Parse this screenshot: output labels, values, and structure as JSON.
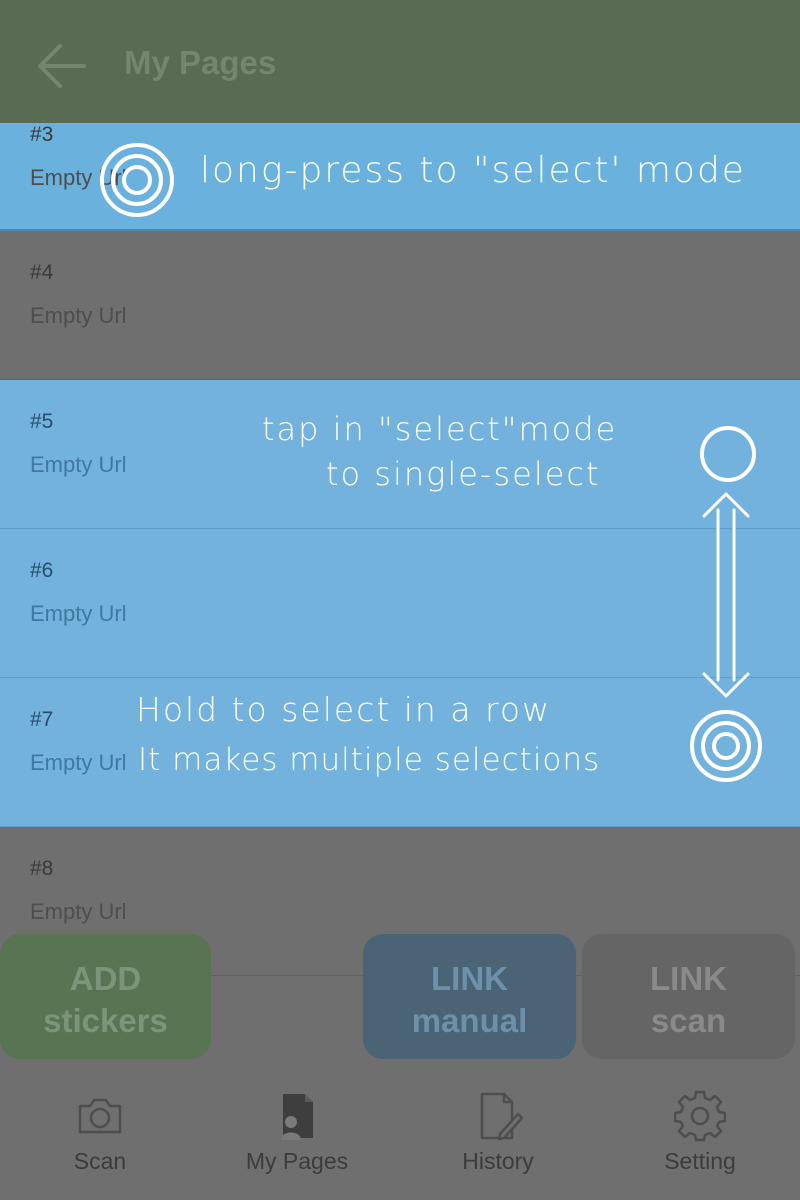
{
  "app_bar": {
    "title": "My Pages"
  },
  "rows": [
    {
      "num": "#3",
      "url": "Empty Url"
    },
    {
      "num": "#4",
      "url": "Empty Url"
    },
    {
      "num": "#5",
      "url": "Empty Url"
    },
    {
      "num": "#6",
      "url": "Empty Url"
    },
    {
      "num": "#7",
      "url": "Empty Url"
    },
    {
      "num": "#8",
      "url": "Empty Url"
    }
  ],
  "annotations": {
    "long_press": "long-press to \"select' mode",
    "tap_line1": "tap in \"select\"mode",
    "tap_line2": "to single-select",
    "hold_line1": "Hold to select in a row",
    "hold_line2": "It makes multiple selections"
  },
  "buttons": {
    "add_line1": "ADD",
    "add_line2": "stickers",
    "manual_line1": "LINK",
    "manual_line2": "manual",
    "scan_line1": "LINK",
    "scan_line2": "scan"
  },
  "nav": {
    "scan": "Scan",
    "my_pages": "My Pages",
    "history": "History",
    "setting": "Setting"
  },
  "colors": {
    "app_bar": "#596b52",
    "highlight": "#72b2dd",
    "overlay": "#6f6f6f"
  }
}
